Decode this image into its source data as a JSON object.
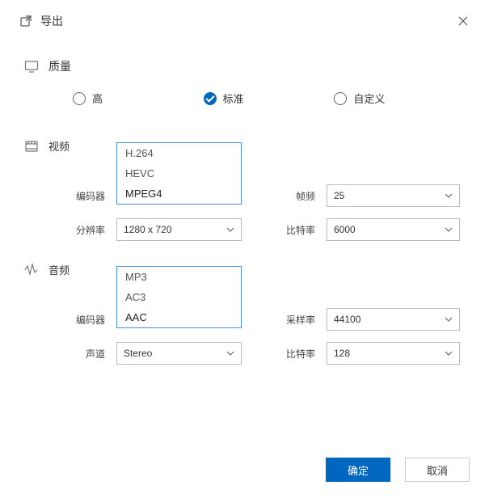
{
  "header": {
    "title": "导出"
  },
  "quality": {
    "section_label": "质量",
    "options": {
      "high": "高",
      "standard": "标准",
      "custom": "自定义"
    },
    "selected": "standard"
  },
  "video": {
    "section_label": "视频",
    "encoder_label": "编码器",
    "encoder_options": [
      "H.264",
      "HEVC",
      "MPEG4"
    ],
    "encoder_selected": "MPEG4",
    "resolution_label": "分辨率",
    "resolution_value": "1280 x 720",
    "fps_label": "帧频",
    "fps_value": "25",
    "bitrate_label": "比特率",
    "bitrate_value": "6000"
  },
  "audio": {
    "section_label": "音频",
    "encoder_label": "编码器",
    "encoder_options": [
      "MP3",
      "AC3",
      "AAC"
    ],
    "encoder_selected": "AAC",
    "channel_label": "声道",
    "channel_value": "Stereo",
    "samplerate_label": "采样率",
    "samplerate_value": "44100",
    "bitrate_label": "比特率",
    "bitrate_value": "128"
  },
  "footer": {
    "ok": "确定",
    "cancel": "取消"
  }
}
